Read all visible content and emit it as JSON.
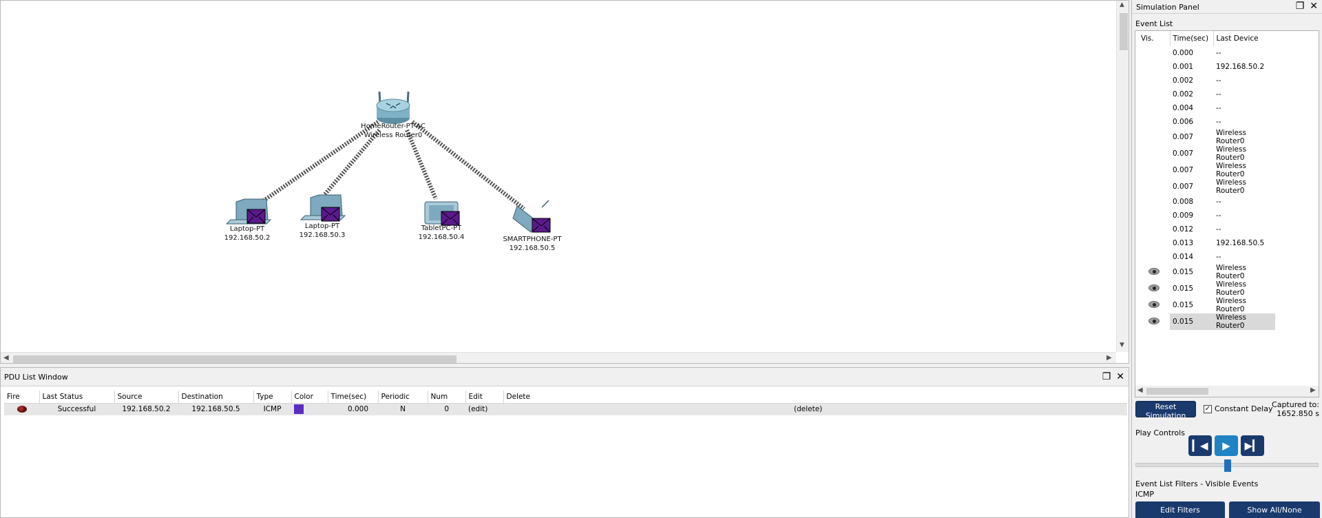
{
  "workspace": {
    "router": {
      "model": "HomeRouter-PT-AC",
      "name": "Wireless Router0"
    },
    "devices": [
      {
        "model": "Laptop-PT",
        "ip": "192.168.50.2"
      },
      {
        "model": "Laptop-PT",
        "ip": "192.168.50.3"
      },
      {
        "model": "TabletPC-PT",
        "ip": "192.168.50.4"
      },
      {
        "model": "SMARTPHONE-PT",
        "ip": "192.168.50.5"
      }
    ]
  },
  "pdu_window": {
    "title": "PDU List Window",
    "columns": [
      "Fire",
      "Last Status",
      "Source",
      "Destination",
      "Type",
      "Color",
      "Time(sec)",
      "Periodic",
      "Num",
      "Edit",
      "Delete"
    ],
    "rows": [
      {
        "last_status": "Successful",
        "source": "192.168.50.2",
        "destination": "192.168.50.5",
        "type": "ICMP",
        "color": "#5b2cc4",
        "time": "0.000",
        "periodic": "N",
        "num": "0",
        "edit": "(edit)",
        "delete": "(delete)"
      }
    ]
  },
  "simulation_panel": {
    "title": "Simulation Panel",
    "event_list_label": "Event List",
    "columns": [
      "Vis.",
      "Time(sec)",
      "Last Device"
    ],
    "events": [
      {
        "time": "0.000",
        "device": "--"
      },
      {
        "time": "0.001",
        "device": "192.168.50.2"
      },
      {
        "time": "0.002",
        "device": "--"
      },
      {
        "time": "0.002",
        "device": "--"
      },
      {
        "time": "0.004",
        "device": "--"
      },
      {
        "time": "0.006",
        "device": "--"
      },
      {
        "time": "0.007",
        "device": "Wireless Router0"
      },
      {
        "time": "0.007",
        "device": "Wireless Router0"
      },
      {
        "time": "0.007",
        "device": "Wireless Router0"
      },
      {
        "time": "0.007",
        "device": "Wireless Router0"
      },
      {
        "time": "0.008",
        "device": "--"
      },
      {
        "time": "0.009",
        "device": "--"
      },
      {
        "time": "0.012",
        "device": "--"
      },
      {
        "time": "0.013",
        "device": "192.168.50.5"
      },
      {
        "time": "0.014",
        "device": "--"
      },
      {
        "time": "0.015",
        "device": "Wireless Router0",
        "visible": true
      },
      {
        "time": "0.015",
        "device": "Wireless Router0",
        "visible": true
      },
      {
        "time": "0.015",
        "device": "Wireless Router0",
        "visible": true
      },
      {
        "time": "0.015",
        "device": "Wireless Router0",
        "visible": true,
        "selected": true
      }
    ],
    "reset_label": "Reset Simulation",
    "constant_delay_label": "Constant Delay",
    "constant_delay_checked": true,
    "captured_label": "Captured to:",
    "captured_value": "1652.850 s",
    "play_controls_label": "Play Controls",
    "filters_label": "Event List Filters - Visible Events",
    "filters_value": "ICMP",
    "edit_filters_label": "Edit Filters",
    "show_all_label": "Show All/None"
  },
  "icons": {
    "restore": "restore-window-icon",
    "close": "close-icon",
    "pdu_envelope": "envelope-icon",
    "visible": "eye-icon",
    "back": "step-back-icon",
    "play": "play-icon",
    "forward": "step-forward-icon"
  },
  "colors": {
    "accent": "#1a3a6e",
    "pdu_envelope": "#5b1a8c",
    "slider_knob": "#1f6fbf"
  }
}
